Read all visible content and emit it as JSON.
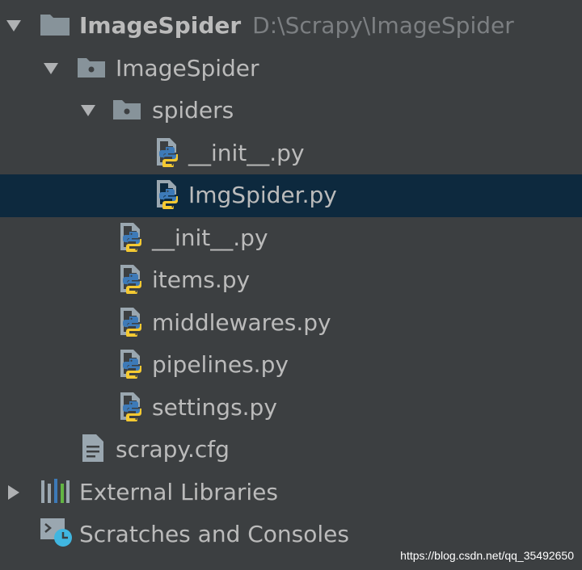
{
  "tree": {
    "root": {
      "name": "ImageSpider",
      "path": "D:\\Scrapy\\ImageSpider"
    },
    "package": {
      "name": "ImageSpider"
    },
    "spiders_folder": {
      "name": "spiders"
    },
    "spiders_files": [
      "__init__.py",
      "ImgSpider.py"
    ],
    "package_files": [
      "__init__.py",
      "items.py",
      "middlewares.py",
      "pipelines.py",
      "settings.py"
    ],
    "cfg_file": "scrapy.cfg",
    "external_libraries": "External Libraries",
    "scratches": "Scratches and Consoles",
    "selected": "ImgSpider.py"
  },
  "icons": {
    "expand": "triangle-down-icon",
    "collapse": "triangle-right-icon",
    "folder": "folder-icon",
    "package": "package-folder-icon",
    "python": "python-file-icon",
    "config": "text-file-icon",
    "libraries": "libraries-icon",
    "scratches": "scratches-console-icon"
  },
  "colors": {
    "background": "#3c3f41",
    "selection": "#0d293e",
    "text": "#bbbbbb",
    "path_text": "#7c7f82"
  },
  "watermark": "https://blog.csdn.net/qq_35492650"
}
